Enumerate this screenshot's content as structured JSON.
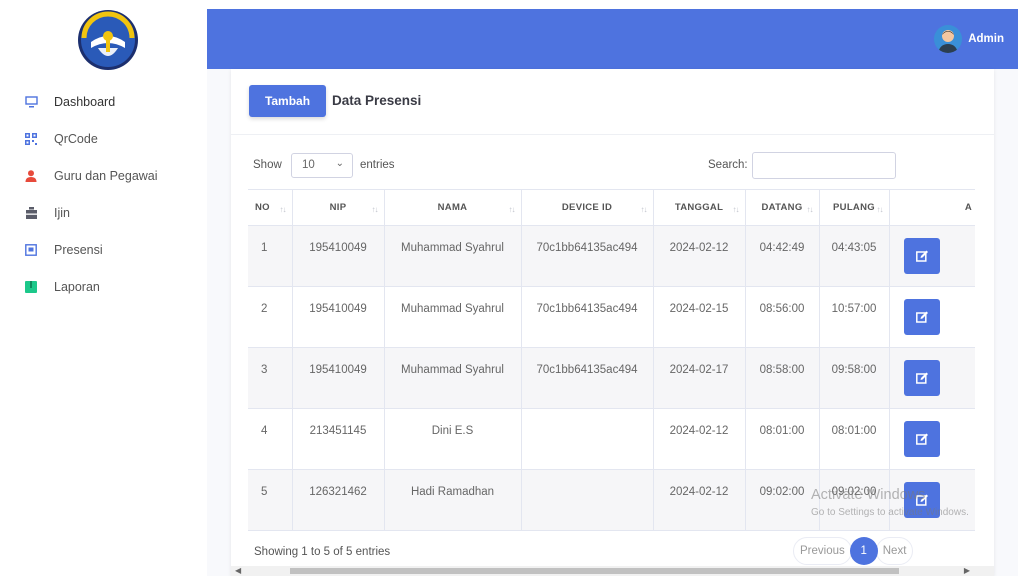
{
  "sidebar": {
    "items": [
      {
        "label": "Dashboard",
        "icon": "monitor-icon",
        "color": "#4e73df"
      },
      {
        "label": "QrCode",
        "icon": "qrcode-icon",
        "color": "#4e73df"
      },
      {
        "label": "Guru dan Pegawai",
        "icon": "user-icon",
        "color": "#e74a3b"
      },
      {
        "label": "Ijin",
        "icon": "briefcase-icon",
        "color": "#5a5c69"
      },
      {
        "label": "Presensi",
        "icon": "id-card-icon",
        "color": "#4e73df"
      },
      {
        "label": "Laporan",
        "icon": "book-icon",
        "color": "#1cc88a"
      }
    ]
  },
  "topbar": {
    "user_name": "Admin",
    "accent": "#4e73df"
  },
  "card": {
    "button_label": "Tambah",
    "title": "Data Presensi"
  },
  "table_controls": {
    "show_label": "Show",
    "length_value": "10",
    "entries_label": "entries",
    "search_label": "Search:",
    "search_value": ""
  },
  "table": {
    "columns": [
      "NO",
      "NIP",
      "NAMA",
      "DEVICE ID",
      "TANGGAL",
      "DATANG",
      "PULANG",
      "A"
    ],
    "rows": [
      {
        "no": "1",
        "nip": "195410049",
        "nama": "Muhammad Syahrul",
        "device_id": "70c1bb64135ac494",
        "tanggal": "2024-02-12",
        "datang": "04:42:49",
        "pulang": "04:43:05"
      },
      {
        "no": "2",
        "nip": "195410049",
        "nama": "Muhammad Syahrul",
        "device_id": "70c1bb64135ac494",
        "tanggal": "2024-02-15",
        "datang": "08:56:00",
        "pulang": "10:57:00"
      },
      {
        "no": "3",
        "nip": "195410049",
        "nama": "Muhammad Syahrul",
        "device_id": "70c1bb64135ac494",
        "tanggal": "2024-02-17",
        "datang": "08:58:00",
        "pulang": "09:58:00"
      },
      {
        "no": "4",
        "nip": "213451145",
        "nama": "Dini E.S",
        "device_id": "",
        "tanggal": "2024-02-12",
        "datang": "08:01:00",
        "pulang": "08:01:00"
      },
      {
        "no": "5",
        "nip": "126321462",
        "nama": "Hadi Ramadhan",
        "device_id": "",
        "tanggal": "2024-02-12",
        "datang": "09:02:00",
        "pulang": "09:02:00"
      }
    ]
  },
  "footer": {
    "info": "Showing 1 to 5 of 5 entries",
    "prev": "Previous",
    "current_page": "1",
    "next": "Next"
  },
  "watermark": {
    "line1": "Activate Windows",
    "line2": "Go to Settings to activate Windows."
  }
}
